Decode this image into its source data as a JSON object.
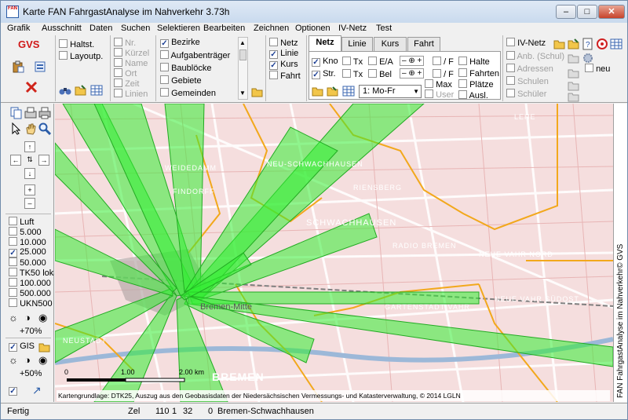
{
  "window": {
    "title": "Karte FAN FahrgastAnalyse im Nahverkehr 3.73h",
    "app_icon_text": "FAN"
  },
  "menu": [
    "Grafik",
    "Ausschnitt",
    "Daten",
    "Suchen",
    "Selektieren",
    "Bearbeiten",
    "Zeichnen",
    "Optionen",
    "IV-Netz",
    "Test"
  ],
  "toolbar": {
    "logo": "GVS",
    "panel_halt": {
      "items": [
        {
          "label": "Haltst.",
          "checked": false
        },
        {
          "label": "Layoutp.",
          "checked": false
        }
      ]
    },
    "panel_labels": {
      "items": [
        "Nr.",
        "Kürzel",
        "Name",
        "Ort",
        "Zeit",
        "Linien"
      ]
    },
    "panel_areas": {
      "items": [
        {
          "label": "Bezirke",
          "checked": true
        },
        {
          "label": "Aufgabenträger",
          "checked": false
        },
        {
          "label": "Baublöcke",
          "checked": false
        },
        {
          "label": "Gebiete",
          "checked": false
        },
        {
          "label": "Gemeinden",
          "checked": false
        }
      ]
    },
    "panel_net": {
      "items": [
        {
          "label": "Netz",
          "checked": false
        },
        {
          "label": "Linie",
          "checked": true
        },
        {
          "label": "Kurs",
          "checked": true
        },
        {
          "label": "Fahrt",
          "checked": false
        }
      ]
    },
    "tabs": [
      "Netz",
      "Linie",
      "Kurs",
      "Fahrt"
    ],
    "netz_tab": {
      "kno": "Kno",
      "str": "Str.",
      "tx1": "Tx",
      "tx2": "Tx",
      "ea": "E/A",
      "bel": "Bel",
      "f1": "/ F",
      "f2": "/ F",
      "max": "Max",
      "user": "User",
      "halte": "Halte",
      "fahrten": "Fahrten",
      "plaetze": "Plätze",
      "ausl": "Ausl.",
      "day_select": "1: Mo-Fr"
    },
    "iv_panel": {
      "title": "IV-Netz",
      "items": [
        "Anb. (Schul)",
        "Adressen",
        "Schulen",
        "Schüler"
      ],
      "neu": "neu"
    }
  },
  "sidebar": {
    "layers": [
      {
        "label": "Luft",
        "checked": false
      },
      {
        "label": "5.000",
        "checked": false
      },
      {
        "label": "10.000",
        "checked": false
      },
      {
        "label": "25.000",
        "checked": true
      },
      {
        "label": "50.000",
        "checked": false
      },
      {
        "label": "TK50 loka",
        "checked": false
      },
      {
        "label": "100.000",
        "checked": false
      },
      {
        "label": "500.000",
        "checked": false
      },
      {
        "label": "UKN500 lo",
        "checked": false
      }
    ],
    "opacity1": "+70%",
    "gis_label": "GIS",
    "opacity2": "+50%"
  },
  "map": {
    "place_labels": [
      "LEHE",
      "NEU-SCHWACHHAUSEN",
      "SCHWACHHAUSEN",
      "RIENSBERG",
      "NEUE VAHR NORD",
      "NEUE VAHR SÜDOST",
      "GARTENSTADT VAHR",
      "RADIO BREMEN",
      "NEUSTADT",
      "BREMEN",
      "Bremen-Mitte",
      "WEIDEDAMM",
      "FINDORFF"
    ],
    "scale": {
      "zero": "0",
      "mid": "1.00",
      "end": "2.00 km"
    },
    "credit": "Kartengrundlage: DTK25, Auszug aus den Geobasisdaten der Niedersächsischen Vermessungs- und Katasterverwaltung, © 2014 LGLN",
    "vertical_credit": "FAN FahrgastAnalyse im Nahverkehr© GVS",
    "colors": {
      "beam": "#33ee33",
      "boundary": "#f2a81c",
      "road": "#ffffff",
      "base": "#f5dede"
    }
  },
  "statusbar": {
    "status": "Fertig",
    "zel_label": "Zel",
    "v1": "110",
    "v2": "1",
    "v3": "32",
    "v4": "0",
    "place": "Bremen-Schwachhausen"
  }
}
